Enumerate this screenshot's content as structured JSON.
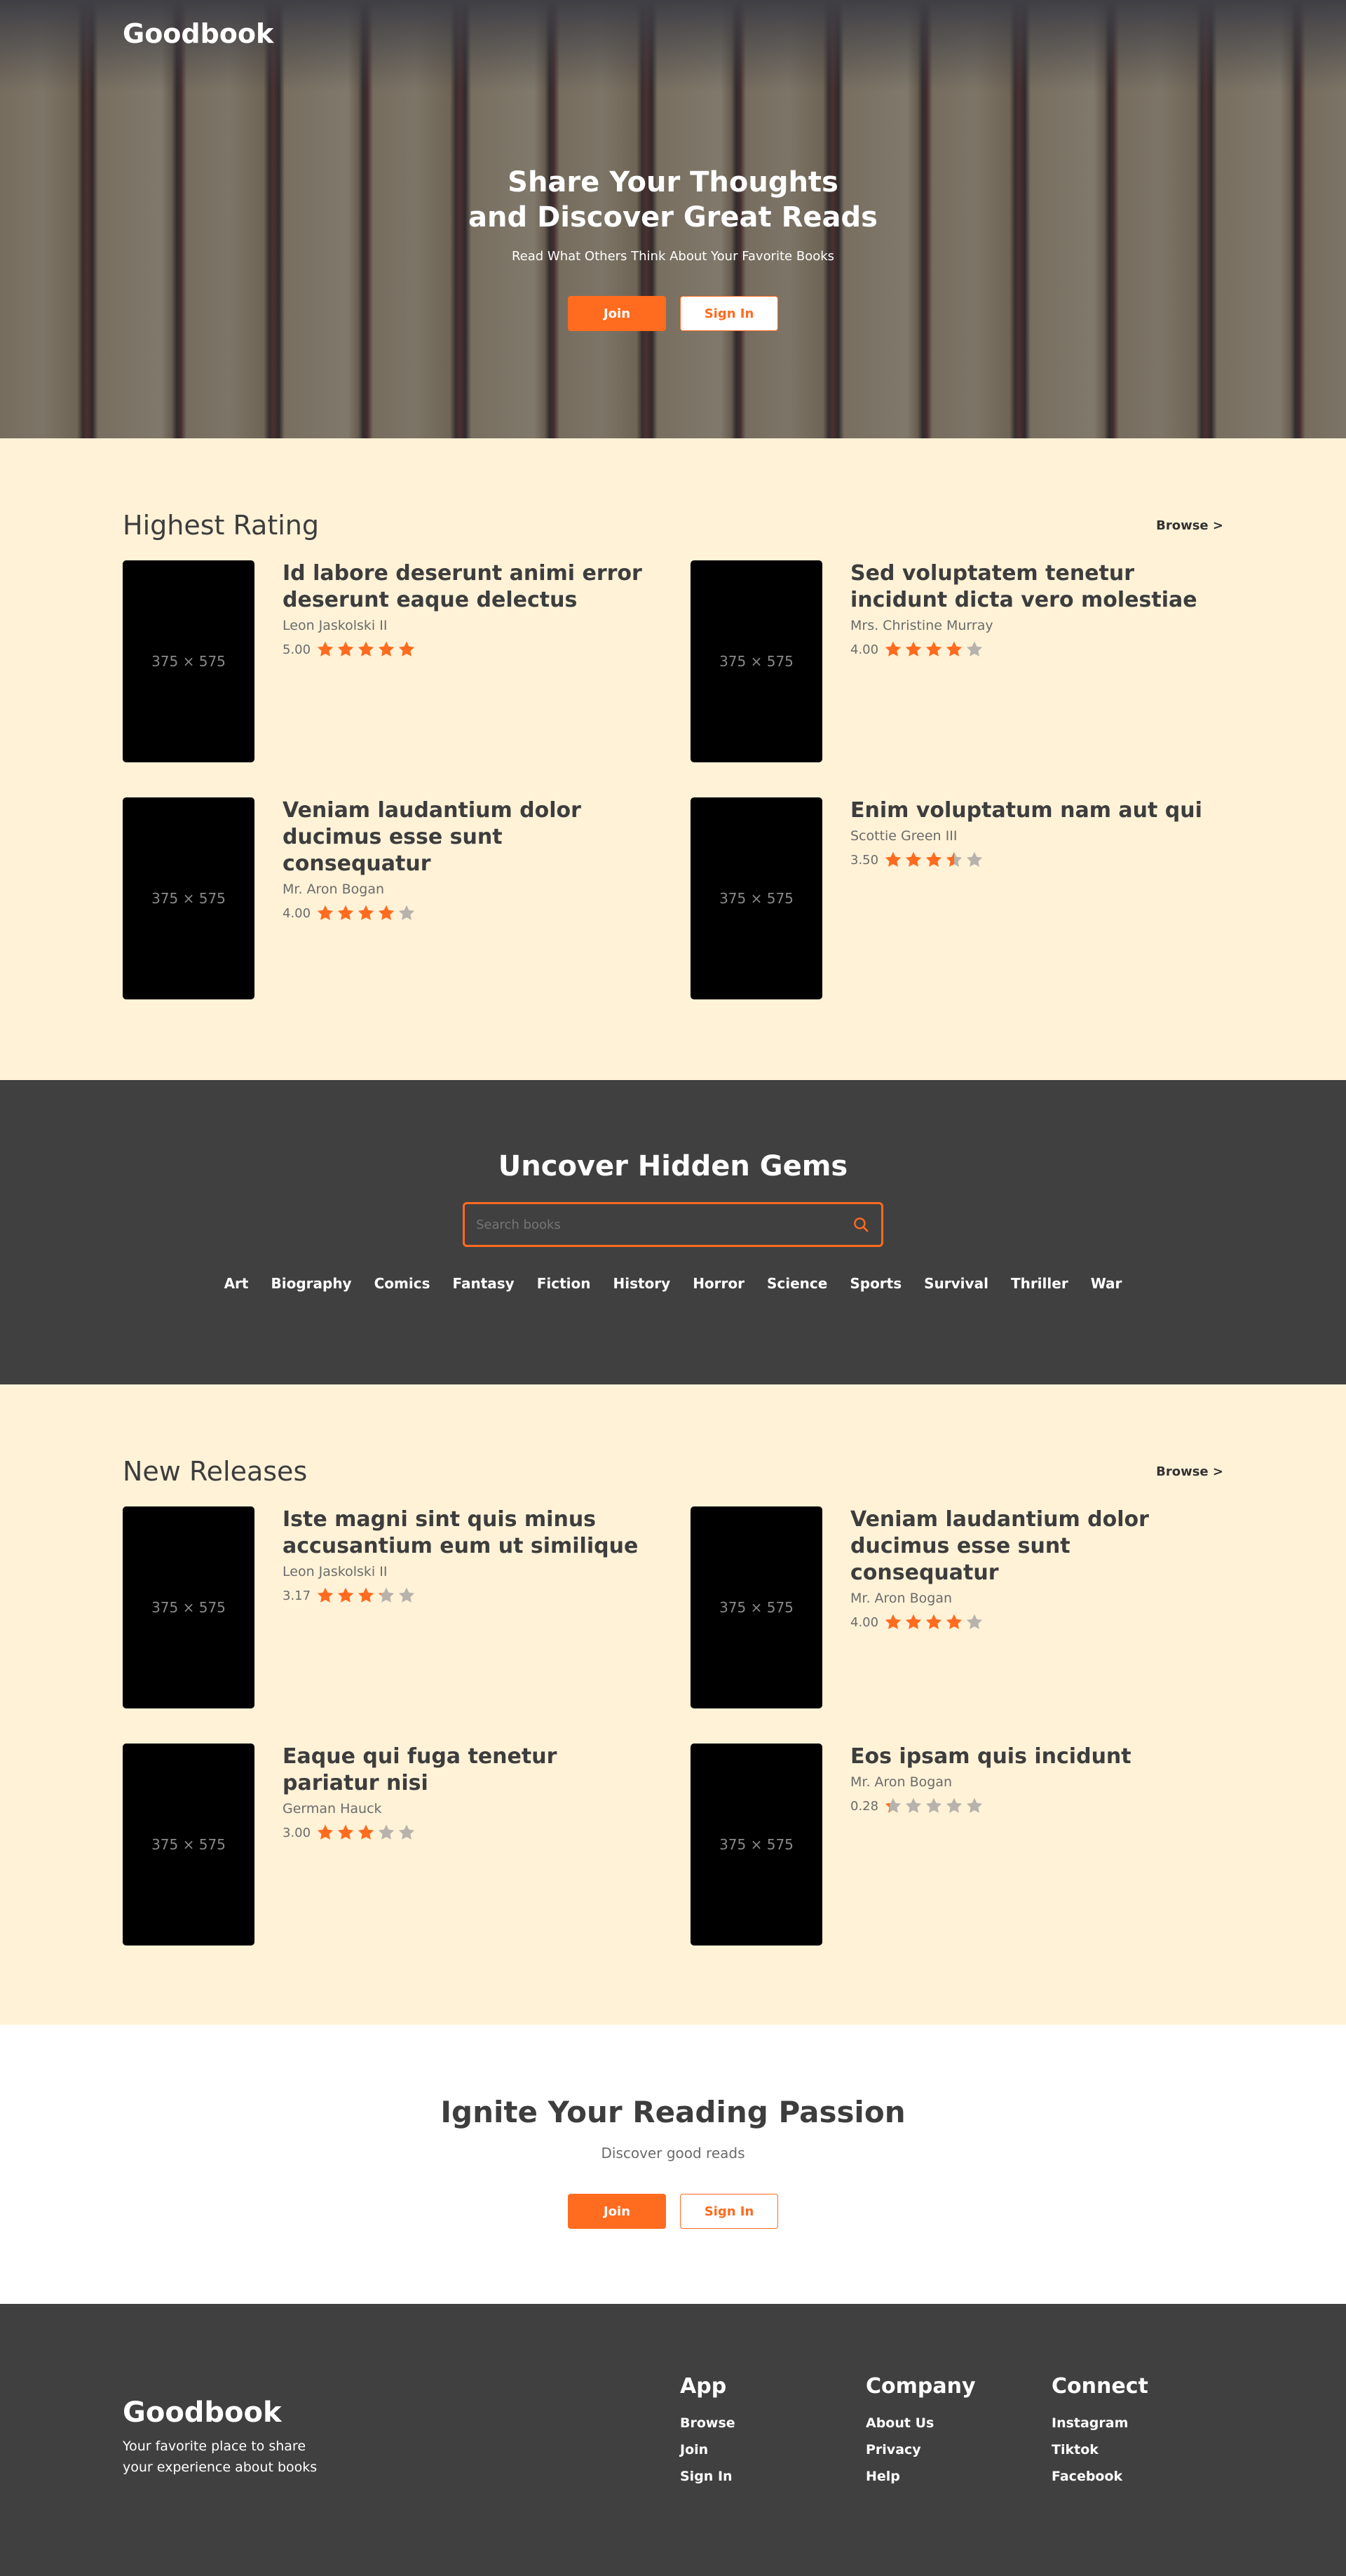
{
  "brand": {
    "name": "Goodbook"
  },
  "hero": {
    "title_line1": "Share Your Thoughts",
    "title_line2": "and Discover Great Reads",
    "subtitle": "Read What Others Think About Your Favorite Books",
    "join_label": "Join",
    "signin_label": "Sign In"
  },
  "highest_rating": {
    "title": "Highest Rating",
    "browse_label": "Browse >",
    "books": [
      {
        "title": "Id labore deserunt animi error deserunt eaque delectus",
        "author": "Leon Jaskolski II",
        "rating": "5.00",
        "stars": 5.0,
        "cover": "375 × 575"
      },
      {
        "title": "Sed voluptatem tenetur incidunt dicta vero molestiae",
        "author": "Mrs. Christine Murray",
        "rating": "4.00",
        "stars": 4.0,
        "cover": "375 × 575"
      },
      {
        "title": "Veniam laudantium dolor ducimus esse sunt consequatur",
        "author": "Mr. Aron Bogan",
        "rating": "4.00",
        "stars": 4.0,
        "cover": "375 × 575"
      },
      {
        "title": "Enim voluptatum nam aut qui",
        "author": "Scottie Green III",
        "rating": "3.50",
        "stars": 3.5,
        "cover": "375 × 575"
      }
    ]
  },
  "gems": {
    "title": "Uncover Hidden Gems",
    "search_placeholder": "Search books",
    "genres": [
      "Art",
      "Biography",
      "Comics",
      "Fantasy",
      "Fiction",
      "History",
      "Horror",
      "Science",
      "Sports",
      "Survival",
      "Thriller",
      "War"
    ]
  },
  "new_releases": {
    "title": "New Releases",
    "browse_label": "Browse >",
    "books": [
      {
        "title": "Iste magni sint quis minus accusantium eum ut similique",
        "author": "Leon Jaskolski II",
        "rating": "3.17",
        "stars": 3.17,
        "cover": "375 × 575"
      },
      {
        "title": "Veniam laudantium dolor ducimus esse sunt consequatur",
        "author": "Mr. Aron Bogan",
        "rating": "4.00",
        "stars": 4.0,
        "cover": "375 × 575"
      },
      {
        "title": "Eaque qui fuga tenetur pariatur nisi",
        "author": "German Hauck",
        "rating": "3.00",
        "stars": 3.0,
        "cover": "375 × 575"
      },
      {
        "title": "Eos ipsam quis incidunt",
        "author": "Mr. Aron Bogan",
        "rating": "0.28",
        "stars": 0.28,
        "cover": "375 × 575"
      }
    ]
  },
  "cta": {
    "title": "Ignite Your Reading Passion",
    "subtitle": "Discover good reads",
    "join_label": "Join",
    "signin_label": "Sign In"
  },
  "footer": {
    "brand": "Goodbook",
    "description": "Your favorite place to share your experience about books",
    "columns": [
      {
        "heading": "App",
        "links": [
          "Browse",
          "Join",
          "Sign In"
        ]
      },
      {
        "heading": "Company",
        "links": [
          "About Us",
          "Privacy",
          "Help"
        ]
      },
      {
        "heading": "Connect",
        "links": [
          "Instagram",
          "Tiktok",
          "Facebook"
        ]
      }
    ]
  },
  "colors": {
    "accent": "#ff6b1f",
    "cream": "#fff2d7",
    "dark": "#404040",
    "star_empty": "#b8b2ac"
  }
}
